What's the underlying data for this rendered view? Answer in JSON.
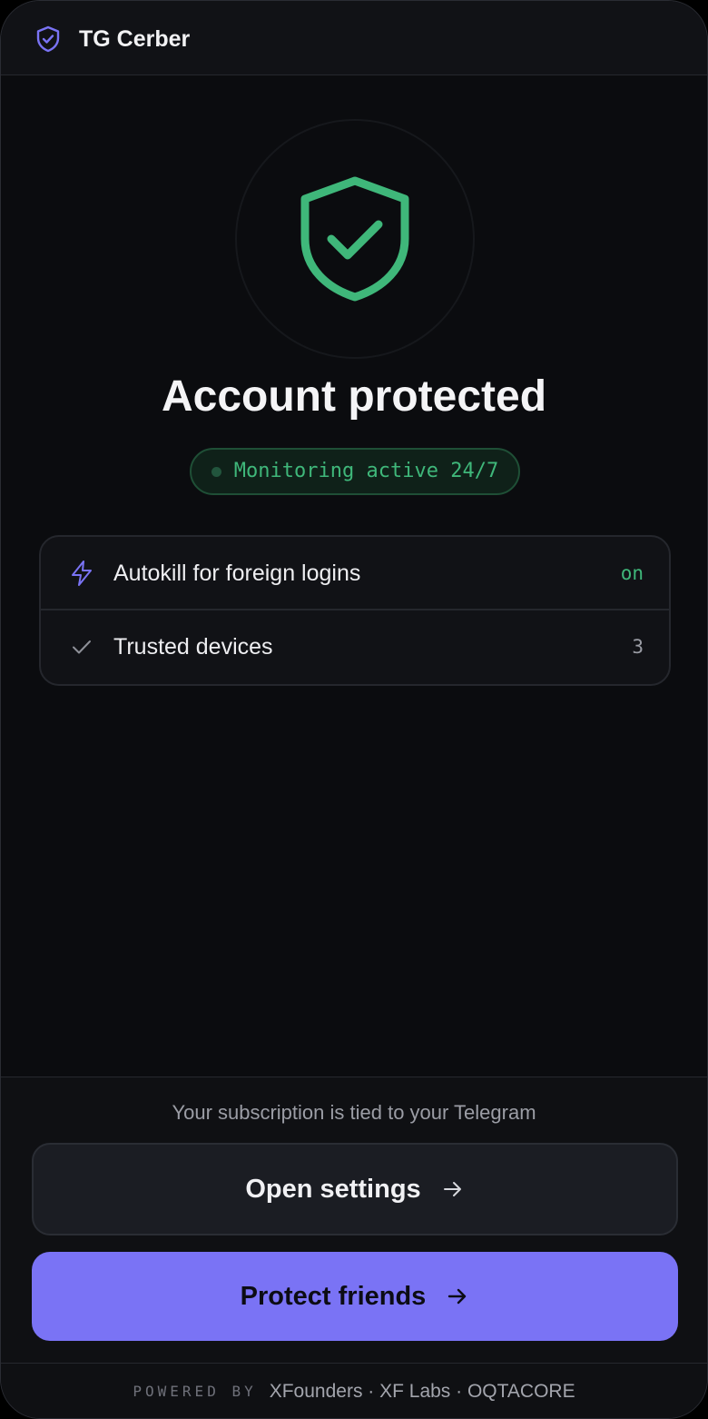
{
  "app": {
    "title": "TG Cerber"
  },
  "status": {
    "title": "Account protected",
    "monitoring": "Monitoring active 24/7"
  },
  "info_rows": [
    {
      "label": "Autokill for foreign logins",
      "value": "on",
      "icon": "lightning-icon"
    },
    {
      "label": "Trusted devices",
      "value": "3",
      "icon": "check-icon"
    }
  ],
  "footer": {
    "subscription_note": "Your subscription is tied to your Telegram",
    "settings_label": "Open settings",
    "friends_label": "Protect friends",
    "powered_label": "POWERED BY",
    "powered_brands": "XFounders · XF Labs · OQTACORE"
  },
  "colors": {
    "accent": "#7a73f5",
    "success": "#3fb77a",
    "background": "#0b0c0f"
  }
}
